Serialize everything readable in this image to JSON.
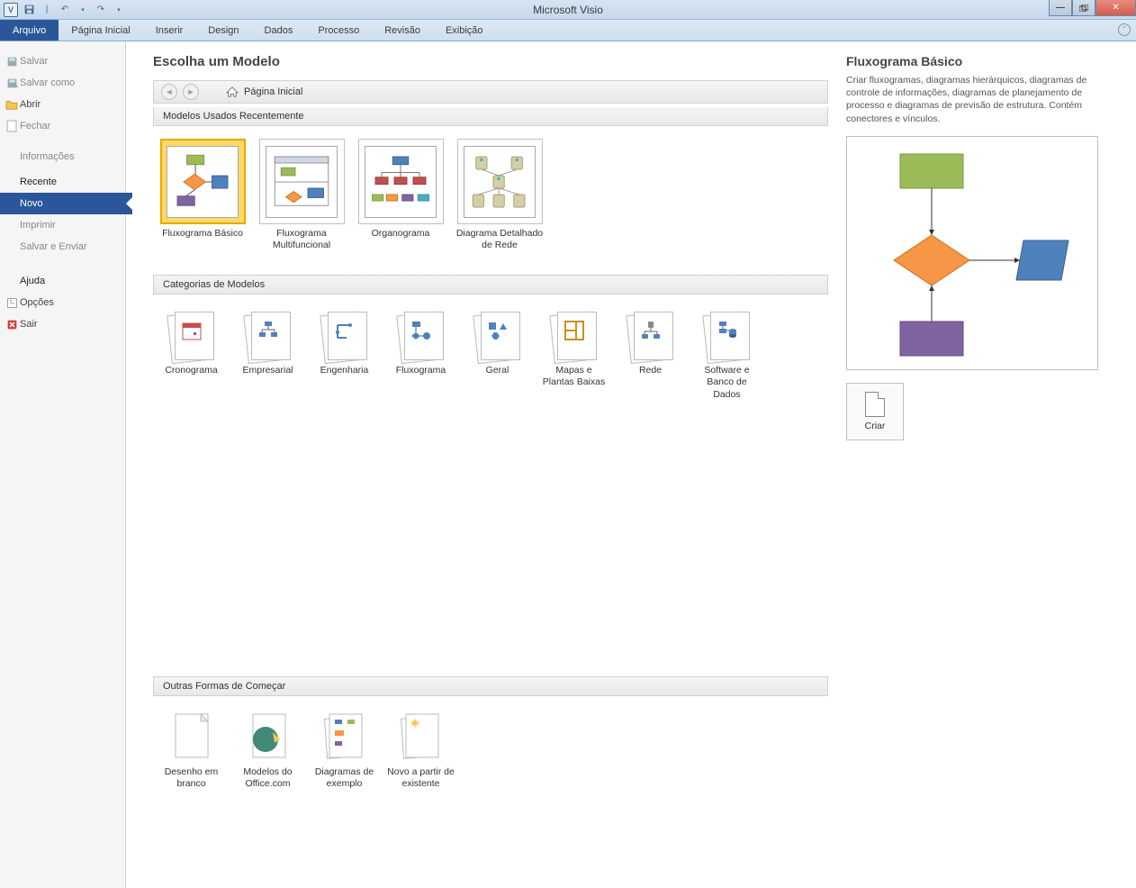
{
  "app": {
    "title": "Microsoft Visio"
  },
  "ribbon": {
    "tabs": [
      "Arquivo",
      "Página Inicial",
      "Inserir",
      "Design",
      "Dados",
      "Processo",
      "Revisão",
      "Exibição"
    ],
    "active": 0
  },
  "sidebar": {
    "salvar": "Salvar",
    "salvar_como": "Salvar como",
    "abrir": "Abrir",
    "fechar": "Fechar",
    "informacoes": "Informações",
    "recente": "Recente",
    "novo": "Novo",
    "imprimir": "Imprimir",
    "salvar_enviar": "Salvar e Enviar",
    "ajuda": "Ajuda",
    "opcoes": "Opções",
    "sair": "Sair"
  },
  "content": {
    "page_title": "Escolha um Modelo",
    "breadcrumb": "Página Inicial",
    "recent_templates_header": "Modelos Usados Recentemente",
    "recent_templates": [
      {
        "label": "Fluxograma Básico"
      },
      {
        "label": "Fluxograma Multifuncional"
      },
      {
        "label": "Organograma"
      },
      {
        "label": "Diagrama Detalhado de Rede"
      }
    ],
    "categories_header": "Categorias de Modelos",
    "categories": [
      {
        "label": "Cronograma"
      },
      {
        "label": "Empresarial"
      },
      {
        "label": "Engenharia"
      },
      {
        "label": "Fluxograma"
      },
      {
        "label": "Geral"
      },
      {
        "label": "Mapas e Plantas Baixas"
      },
      {
        "label": "Rede"
      },
      {
        "label": "Software e Banco de Dados"
      }
    ],
    "other_ways_header": "Outras Formas de Começar",
    "other_ways": [
      {
        "label": "Desenho em branco"
      },
      {
        "label": "Modelos do Office.com"
      },
      {
        "label": "Diagramas de exemplo"
      },
      {
        "label": "Novo a partir de existente"
      }
    ]
  },
  "preview": {
    "title": "Fluxograma Básico",
    "desc": "Criar fluxogramas, diagramas hierárquicos, diagramas de controle de informações, diagramas de planejamento de processo e diagramas de previsão de estrutura. Contém conectores e vínculos.",
    "create": "Criar"
  }
}
